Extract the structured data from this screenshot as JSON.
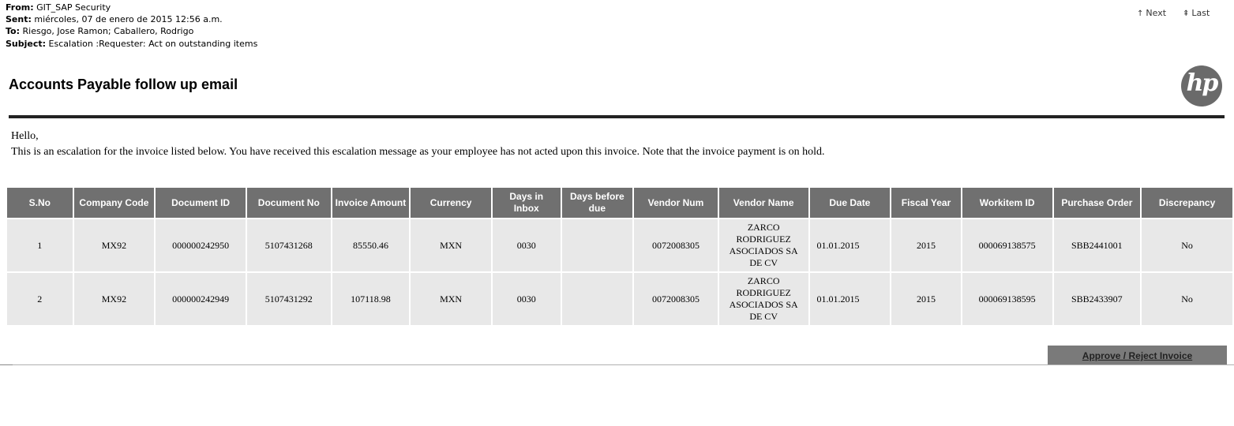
{
  "email": {
    "from_label": "From:",
    "from": "GIT_SAP Security",
    "sent_label": "Sent:",
    "sent": "miércoles, 07 de enero de 2015 12:56 a.m.",
    "to_label": "To:",
    "to": "Riesgo, Jose Ramon; Caballero, Rodrigo",
    "subject_label": "Subject:",
    "subject": "Escalation :Requester: Act on outstanding items"
  },
  "nav": {
    "next": "Next",
    "last": "Last",
    "next_icon": "up-arrow-icon",
    "last_icon": "double-up-arrow-icon"
  },
  "page": {
    "title": "Accounts Payable follow up email",
    "logo": "hp",
    "greeting": "Hello,",
    "message": "This is an escalation for the invoice listed below. You have received this escalation message as your employee has not acted upon this invoice. Note that the invoice payment is on hold."
  },
  "table": {
    "headers": [
      "S.No",
      "Company Code",
      "Document ID",
      "Document No",
      "Invoice Amount",
      "Currency",
      "Days in Inbox",
      "Days before due",
      "Vendor Num",
      "Vendor Name",
      "Due Date",
      "Fiscal Year",
      "Workitem ID",
      "Purchase Order",
      "Discrepancy"
    ],
    "rows": [
      [
        "1",
        "MX92",
        "000000242950",
        "5107431268",
        "85550.46",
        "MXN",
        "0030",
        "",
        "0072008305",
        "ZARCO RODRIGUEZ ASOCIADOS SA DE CV",
        "01.01.2015",
        "2015",
        "000069138575",
        "SBB2441001",
        "No"
      ],
      [
        "2",
        "MX92",
        "000000242949",
        "5107431292",
        "107118.98",
        "MXN",
        "0030",
        "",
        "0072008305",
        "ZARCO RODRIGUEZ ASOCIADOS SA DE CV",
        "01.01.2015",
        "2015",
        "000069138595",
        "SBB2433907",
        "No"
      ]
    ]
  },
  "actions": {
    "approve_reject": "Approve / Reject Invoice"
  },
  "colors": {
    "header_bg": "#707070",
    "cell_bg": "#e8e8e8",
    "rule": "#222222",
    "logo_bg": "#6a6a6a"
  }
}
